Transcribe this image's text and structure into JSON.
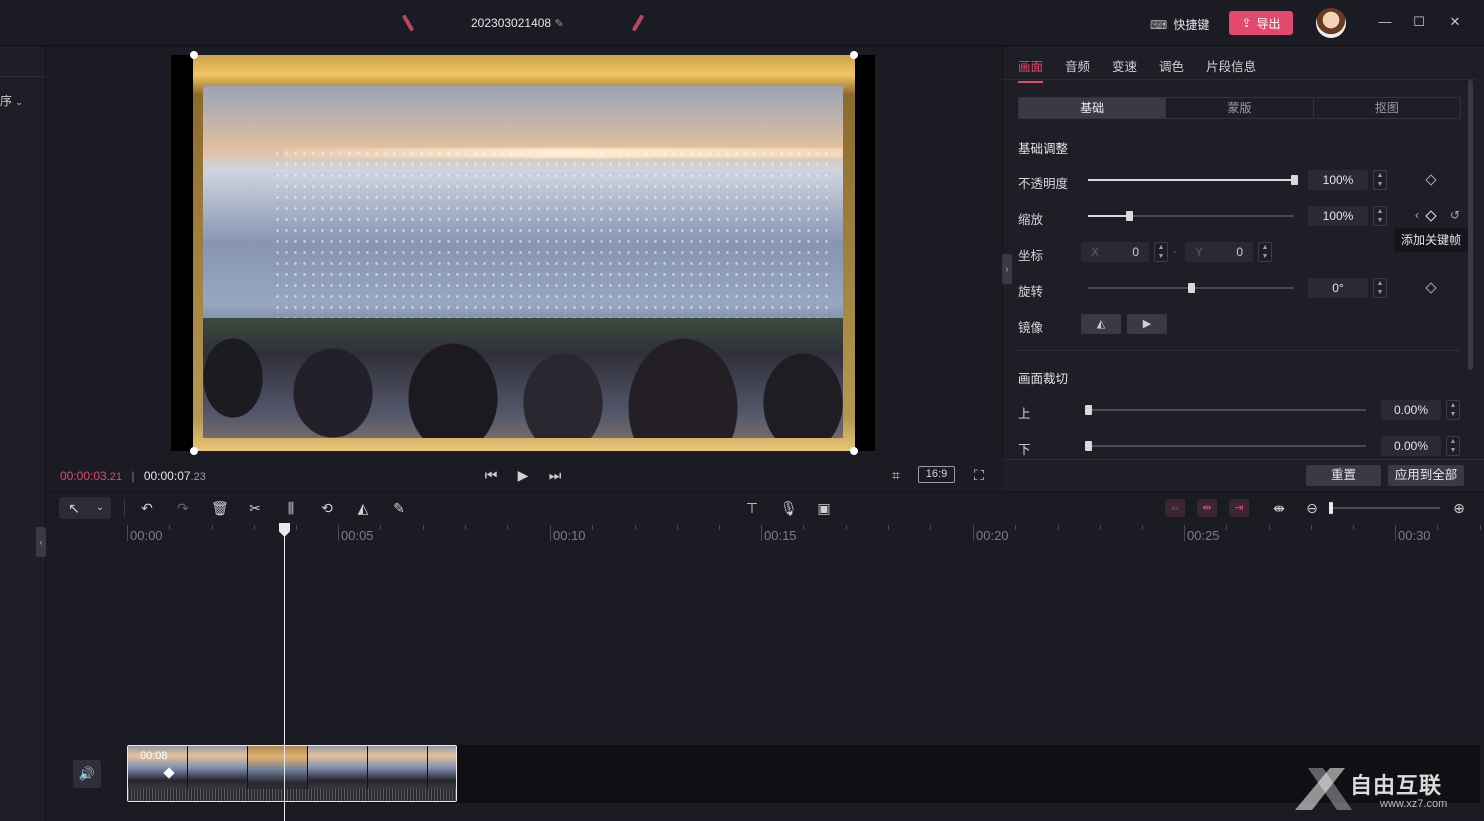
{
  "window": {
    "project_title": "202303021408",
    "shortcut_label": "快捷键",
    "export_label": "导出"
  },
  "left": {
    "sort_label": "非序"
  },
  "preview": {
    "current_time_main": "00:00:03",
    "current_time_frac": ".21",
    "total_time_main": "00:00:07",
    "total_time_frac": ".23",
    "aspect_ratio": "16:9"
  },
  "panel": {
    "tabs": [
      "画面",
      "音频",
      "变速",
      "调色",
      "片段信息"
    ],
    "active_tab": 0,
    "subtabs": [
      "基础",
      "蒙版",
      "抠图"
    ],
    "active_subtab": 0,
    "basic_title": "基础调整",
    "opacity": {
      "label": "不透明度",
      "value": "100%",
      "level": 1.0
    },
    "scale": {
      "label": "缩放",
      "value": "100%",
      "level": 0.2
    },
    "position": {
      "label": "坐标",
      "x_label": "X",
      "x_value": "0",
      "y_label": "Y",
      "y_value": "0"
    },
    "rotation": {
      "label": "旋转",
      "value": "0°",
      "level": 0.5
    },
    "mirror": {
      "label": "镜像"
    },
    "crop_title": "画面裁切",
    "crop_top": {
      "label": "上",
      "value": "0.00%"
    },
    "crop_bottom": {
      "label": "下",
      "value": "0.00%"
    },
    "tooltip": "添加关键帧",
    "reset_label": "重置",
    "apply_all_label": "应用到全部"
  },
  "timeline": {
    "ruler": [
      "00:00",
      "00:05",
      "00:10",
      "00:15",
      "00:20",
      "00:25",
      "00:30"
    ],
    "clip_duration": "00:08"
  },
  "watermark": {
    "brand": "自由互联",
    "url": "www.xz7.com"
  },
  "colors": {
    "accent": "#e2496c",
    "background": "#1b1b23",
    "panel": "#1e1e26"
  }
}
